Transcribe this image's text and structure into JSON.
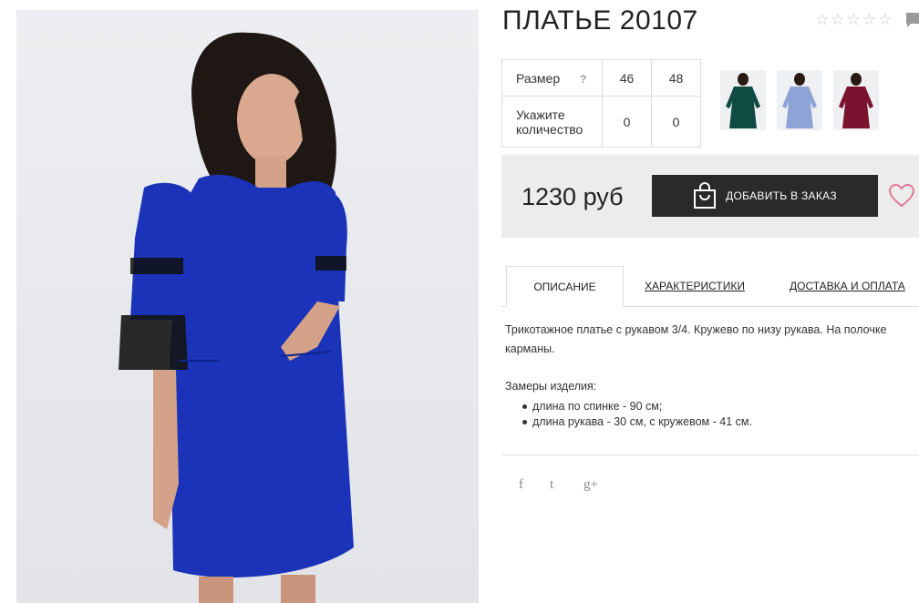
{
  "product": {
    "title": "ПЛАТЬЕ 20107",
    "rating": {
      "stars": [
        "☆",
        "☆",
        "☆",
        "☆",
        "☆"
      ],
      "value": 0
    }
  },
  "size_table": {
    "size_label": "Размер",
    "help_mark": "?",
    "sizes": [
      "46",
      "48"
    ],
    "qty_label_line1": "Укажите",
    "qty_label_line2": "количество",
    "quantities": [
      "0",
      "0"
    ]
  },
  "colors": {
    "thumbs": [
      "#0f4a43",
      "#8ea3d6",
      "#7a1230"
    ]
  },
  "order": {
    "price": "1230 руб",
    "button_label": "ДОБАВИТЬ В ЗАКАЗ"
  },
  "tabs": {
    "description": "ОПИСАНИЕ",
    "characteristics": "ХАРАКТЕРИСТИКИ",
    "delivery": "ДОСТАВКА И ОПЛАТА"
  },
  "description": {
    "text": "Трикотажное платье с рукавом 3/4. Кружево по низу рукава. На полочке карманы.",
    "measures_title": "Замеры изделия:",
    "measures": [
      "длина по спинке - 90 см;",
      "длина рукава - 30 см, с кружевом - 41 см."
    ]
  },
  "social": {
    "facebook": "f",
    "twitter": "t",
    "google": "g+"
  },
  "theme": {
    "dress_color": "#1a33b8",
    "button_bg": "#2a2a2a",
    "heart_color": "#e07a95"
  }
}
